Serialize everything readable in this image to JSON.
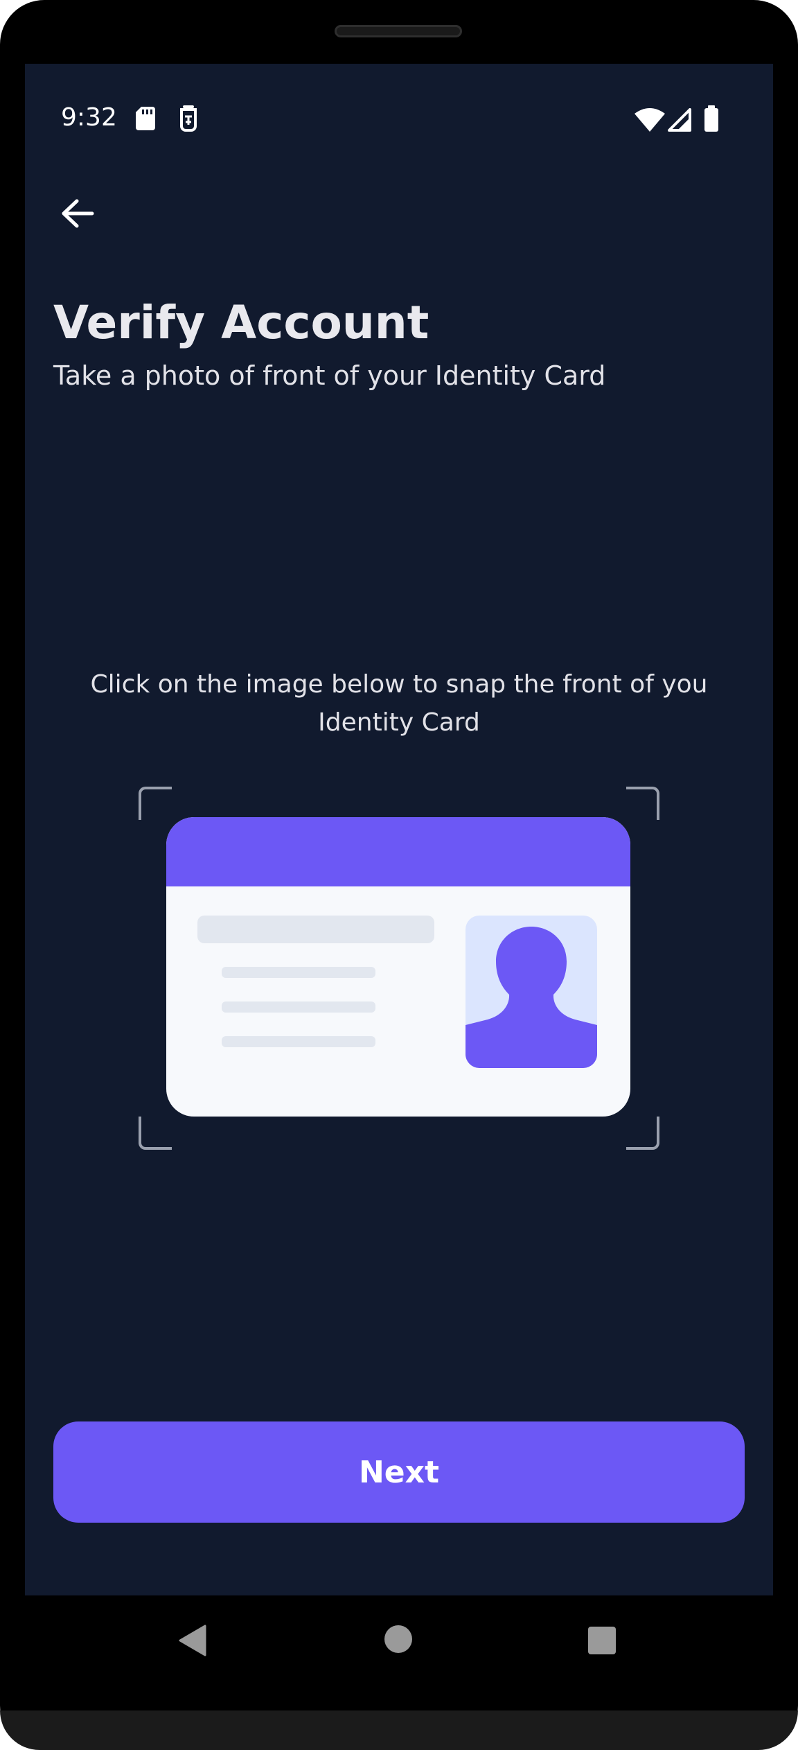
{
  "status_bar": {
    "time": "9:32",
    "icons": [
      "sd-card-icon",
      "sim-icon",
      "wifi-icon",
      "signal-icon",
      "battery-icon"
    ]
  },
  "header": {
    "back_icon": "arrow-left-icon",
    "title": "Verify Account",
    "subtitle": "Take a photo of front of your Identity Card"
  },
  "main": {
    "instruction": "Click on the image below to snap the front of you Identity Card",
    "id_card_icon": "id-card-illustration"
  },
  "footer": {
    "next_label": "Next"
  },
  "nav_bar": {
    "icons": [
      "nav-back-icon",
      "nav-home-icon",
      "nav-recents-icon"
    ]
  },
  "colors": {
    "background": "#111a2e",
    "accent": "#6c58f5",
    "card_body": "#f7f9fc",
    "card_placeholder": "#e2e7ef",
    "photo_bg": "#dbe5fe"
  }
}
